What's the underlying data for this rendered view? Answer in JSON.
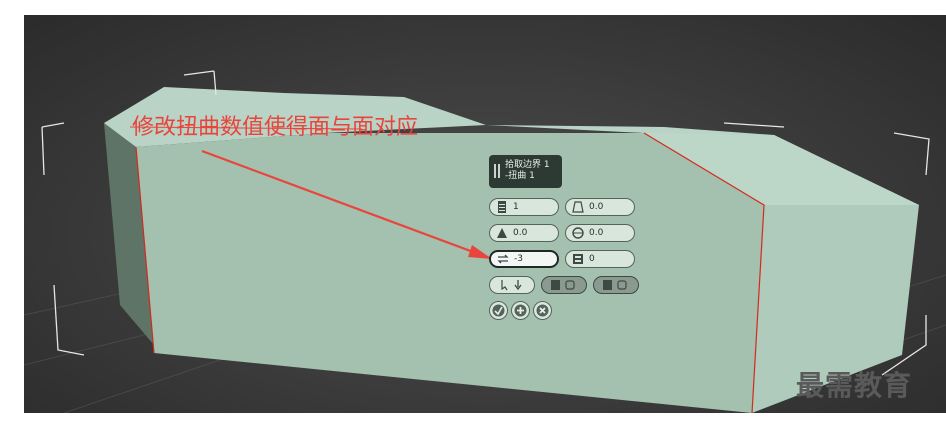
{
  "annotation": {
    "text": "修改扭曲数值使得面与面对应",
    "color": "#e8453c"
  },
  "caddy": {
    "title_line1": "拾取边界 1",
    "title_line2": "-扭曲 1",
    "fields": {
      "segments": "1",
      "taper": "0.0",
      "smooth": "0.0",
      "smooth2": "0.0",
      "twist": "-3",
      "relax": "0"
    }
  },
  "watermark": "最需教育",
  "colors": {
    "mesh_face": "#a5c2b1",
    "mesh_edge": "#d42a1c",
    "viewport_bg": "#3b3b3b",
    "bbox": "#e0e0e0"
  },
  "icons": [
    "segments-icon",
    "taper-icon",
    "smooth-icon",
    "twist-icon",
    "relax-icon",
    "pick-icon",
    "apply-icon",
    "add-icon",
    "cancel-icon"
  ]
}
